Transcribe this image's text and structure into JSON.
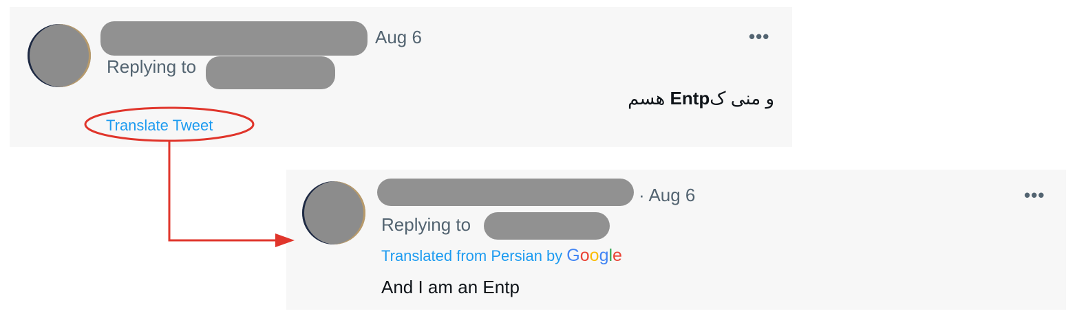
{
  "original_tweet": {
    "date": "Aug 6",
    "more_label": "•••",
    "replying_label": "Replying to",
    "text_prefix": "و منی ک",
    "text_bold": "Entp",
    "text_suffix": " هسم",
    "translate_label": "Translate Tweet"
  },
  "translated_tweet": {
    "date_sep": "· Aug 6",
    "more_label": "•••",
    "replying_label": "Replying to",
    "translated_from": "Translated from Persian by",
    "google_letters": [
      "G",
      "o",
      "o",
      "g",
      "l",
      "e"
    ],
    "text": "And I am an Entp"
  },
  "colors": {
    "link": "#1d9bf0",
    "annotation": "#e0352b",
    "card_bg": "#f7f7f7",
    "redaction": "#919191"
  },
  "icons": {
    "more": "more-horizontal-icon",
    "arrow": "arrow-right-icon"
  }
}
